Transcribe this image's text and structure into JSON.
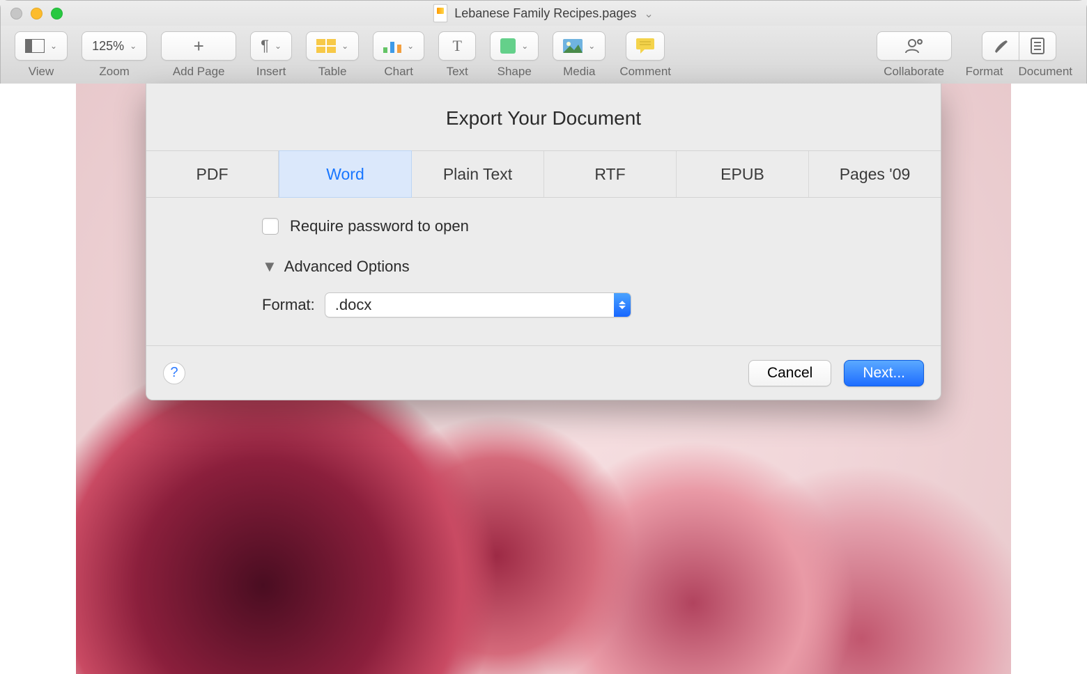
{
  "window": {
    "document_title": "Lebanese Family Recipes.pages"
  },
  "toolbar": {
    "view": "View",
    "zoom": "Zoom",
    "zoom_value": "125%",
    "add_page": "Add Page",
    "insert": "Insert",
    "table": "Table",
    "chart": "Chart",
    "text": "Text",
    "shape": "Shape",
    "media": "Media",
    "comment": "Comment",
    "collaborate": "Collaborate",
    "format": "Format",
    "document": "Document"
  },
  "export_dialog": {
    "title": "Export Your Document",
    "tabs": {
      "pdf": "PDF",
      "word": "Word",
      "plain_text": "Plain Text",
      "rtf": "RTF",
      "epub": "EPUB",
      "pages09": "Pages '09"
    },
    "active_tab": "word",
    "require_password_label": "Require password to open",
    "require_password_checked": false,
    "advanced_options_label": "Advanced Options",
    "format_label": "Format:",
    "format_value": ".docx",
    "help_tooltip": "?",
    "cancel": "Cancel",
    "next": "Next..."
  }
}
